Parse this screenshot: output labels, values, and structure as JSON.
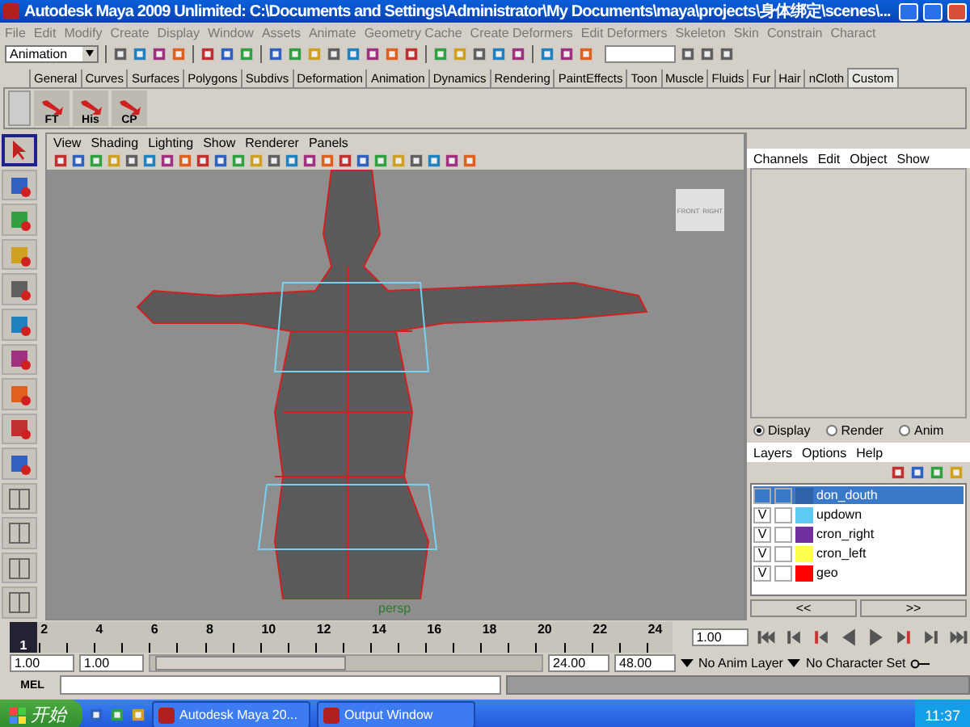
{
  "window": {
    "title": "Autodesk Maya 2009 Unlimited: C:\\Documents and Settings\\Administrator\\My Documents\\maya\\projects\\身体绑定\\scenes\\..."
  },
  "menu": [
    "File",
    "Edit",
    "Modify",
    "Create",
    "Display",
    "Window",
    "Assets",
    "Animate",
    "Geometry Cache",
    "Create Deformers",
    "Edit Deformers",
    "Skeleton",
    "Skin",
    "Constrain",
    "Charact"
  ],
  "status_line": {
    "mode": "Animation"
  },
  "shelf_tabs": [
    {
      "label": "General",
      "selected": false
    },
    {
      "label": "Curves",
      "selected": false
    },
    {
      "label": "Surfaces",
      "selected": false
    },
    {
      "label": "Polygons",
      "selected": false
    },
    {
      "label": "Subdivs",
      "selected": false
    },
    {
      "label": "Deformation",
      "selected": false
    },
    {
      "label": "Animation",
      "selected": false
    },
    {
      "label": "Dynamics",
      "selected": false
    },
    {
      "label": "Rendering",
      "selected": false
    },
    {
      "label": "PaintEffects",
      "selected": false
    },
    {
      "label": "Toon",
      "selected": false
    },
    {
      "label": "Muscle",
      "selected": false
    },
    {
      "label": "Fluids",
      "selected": false
    },
    {
      "label": "Fur",
      "selected": false
    },
    {
      "label": "Hair",
      "selected": false
    },
    {
      "label": "nCloth",
      "selected": false
    },
    {
      "label": "Custom",
      "selected": true
    }
  ],
  "shelf_buttons": [
    "FT",
    "His",
    "CP"
  ],
  "panel_menu": [
    "View",
    "Shading",
    "Lighting",
    "Show",
    "Renderer",
    "Panels"
  ],
  "viewport": {
    "camera": "persp",
    "view_cube": [
      "FRONT",
      "RIGHT"
    ]
  },
  "channel_box": {
    "menu": [
      "Channels",
      "Edit",
      "Object",
      "Show"
    ]
  },
  "layer_editor": {
    "modes": [
      {
        "label": "Display",
        "selected": true
      },
      {
        "label": "Render",
        "selected": false
      },
      {
        "label": "Anim",
        "selected": false
      }
    ],
    "menu": [
      "Layers",
      "Options",
      "Help"
    ],
    "layers": [
      {
        "name": "don_douth",
        "selected": true,
        "color": "#2f62a8"
      },
      {
        "name": "updown",
        "visibility": "V",
        "selected": false,
        "color": "#5ccaf2"
      },
      {
        "name": "cron_right",
        "visibility": "V",
        "selected": false,
        "color": "#7030a0"
      },
      {
        "name": "cron_left",
        "visibility": "V",
        "selected": false,
        "color": "#ffff50"
      },
      {
        "name": "geo",
        "visibility": "V",
        "selected": false,
        "color": "#ff0000"
      }
    ],
    "nav": [
      "<<",
      ">>"
    ]
  },
  "timeline": {
    "ticks": [
      "2",
      "4",
      "6",
      "8",
      "10",
      "12",
      "14",
      "16",
      "18",
      "20",
      "22",
      "24"
    ],
    "current_frame": "1",
    "level": 0,
    "current_time": "1.00"
  },
  "range": {
    "start": "1.00",
    "playback_start": "1.00",
    "playback_end": "24.00",
    "end": "48.00",
    "level": 0.48,
    "anim_layer": "No Anim Layer",
    "character_set": "No Character Set"
  },
  "command_line": {
    "label": "MEL"
  },
  "taskbar": {
    "start": "开始",
    "tasks": [
      "Autodesk Maya 20...",
      "Output Window"
    ],
    "clock": "11:37"
  }
}
